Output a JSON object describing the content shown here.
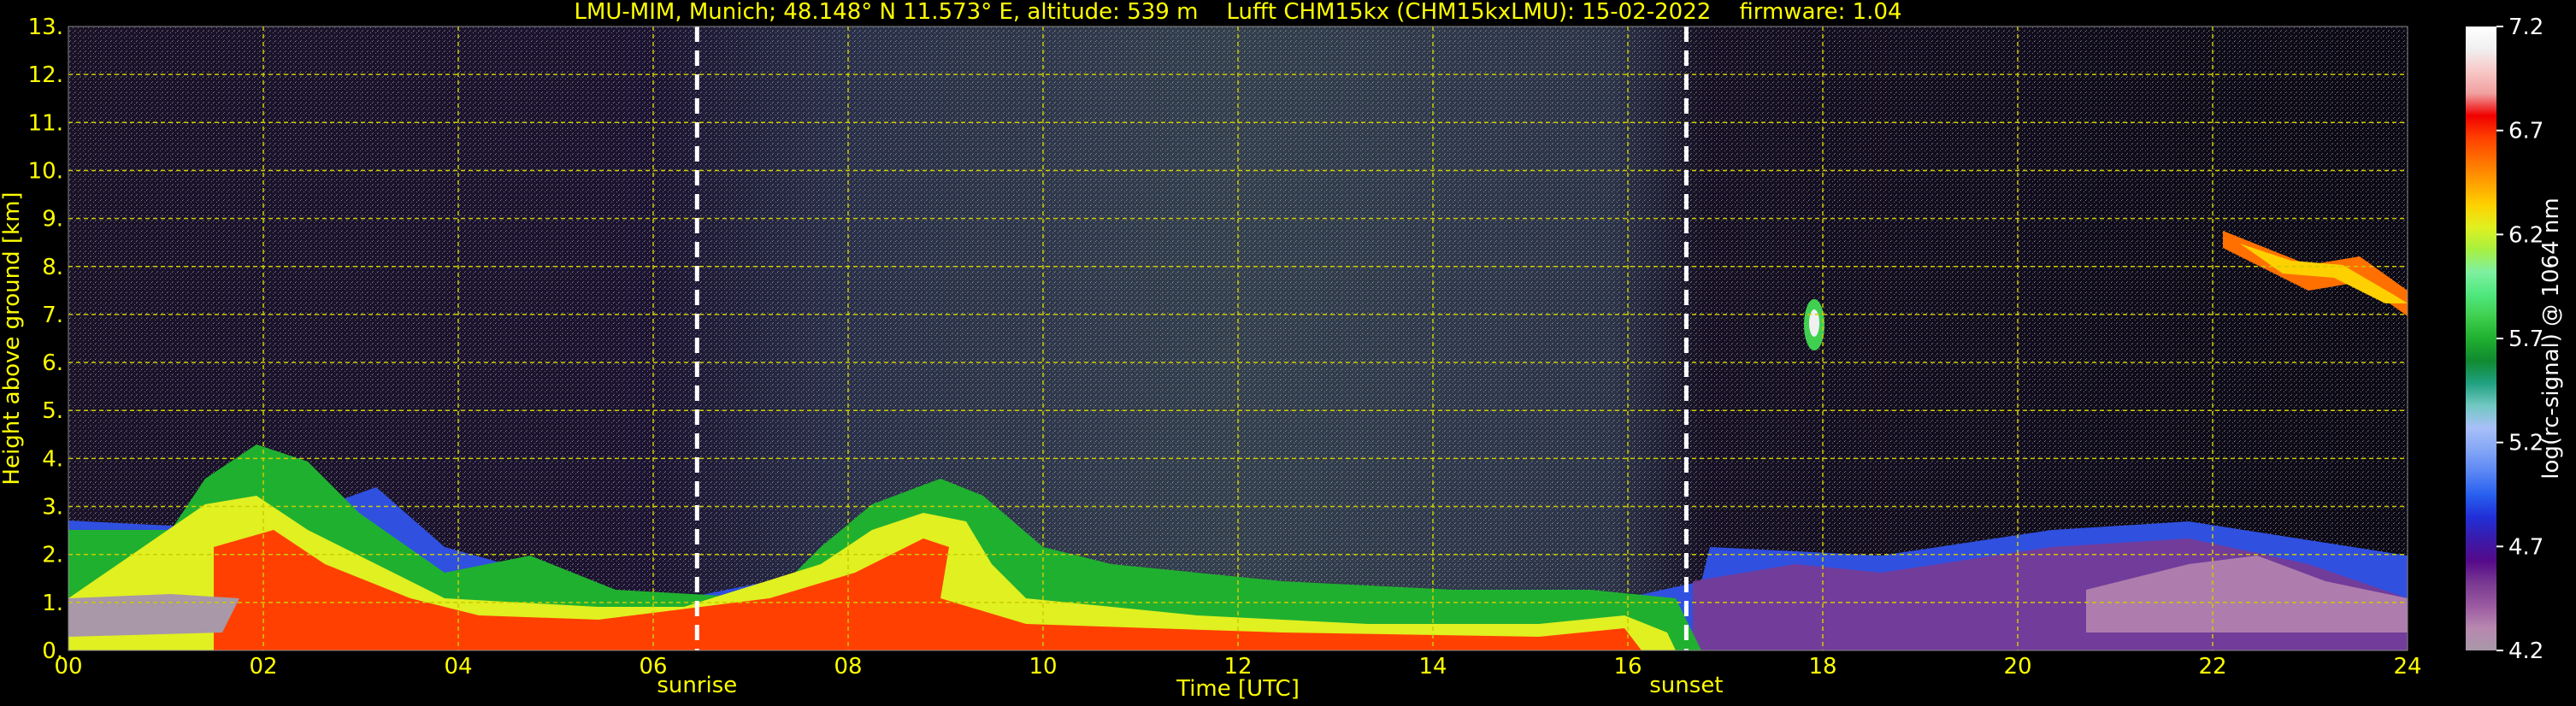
{
  "chart_data": {
    "type": "heatmap",
    "title": "LMU-MIM, Munich; 48.148° N 11.573° E, altitude: 539 m    Lufft CHM15kx (CHM15kxLMU): 15-02-2022    firmware: 1.04",
    "xlabel": "Time [UTC]",
    "ylabel": "Height above ground [km]",
    "xlim": [
      0,
      24
    ],
    "ylim": [
      0,
      13
    ],
    "x_ticks": [
      "00",
      "02",
      "04",
      "06",
      "08",
      "10",
      "12",
      "14",
      "16",
      "18",
      "20",
      "22",
      "24"
    ],
    "y_ticks": [
      "0.",
      "1.",
      "2.",
      "3.",
      "4.",
      "5.",
      "6.",
      "7.",
      "8.",
      "9.",
      "10.",
      "11.",
      "12.",
      "13."
    ],
    "grid": true,
    "sun_events": [
      {
        "label": "sunrise",
        "time": 6.45
      },
      {
        "label": "sunset",
        "time": 16.6
      }
    ],
    "colorbar": {
      "label": "log(rc-signal) @ 1064 nm",
      "ticks": [
        "4.2",
        "4.7",
        "5.2",
        "5.7",
        "6.2",
        "6.7",
        "7.2"
      ],
      "min": 4.2,
      "max": 7.2,
      "colors": [
        "#a898a8",
        "#b888b0",
        "#9a5aa0",
        "#7a3a92",
        "#560a8a",
        "#3a1aaa",
        "#2030d8",
        "#2860ee",
        "#5a86f4",
        "#84a6f6",
        "#a8c0f8",
        "#70c8c0",
        "#20a080",
        "#108a30",
        "#20b030",
        "#40d050",
        "#50e880",
        "#80f0a0",
        "#a8f040",
        "#e0f020",
        "#ffd000",
        "#ffa000",
        "#ff7000",
        "#ff4000",
        "#f00000",
        "#f0a0a0",
        "#f8c8c8",
        "#f0f0f0",
        "#ffffff"
      ]
    },
    "features": [
      {
        "name": "boundary layer aerosol",
        "x": [
          0,
          24
        ],
        "y": [
          0,
          2.5
        ]
      },
      {
        "name": "cloud",
        "x": [
          17.7,
          18.0
        ],
        "y": [
          6.4,
          7.3
        ]
      },
      {
        "name": "cloud",
        "x": [
          22.0,
          24.0
        ],
        "y": [
          6.9,
          9.0
        ]
      }
    ]
  },
  "colors": {
    "text": "#ffff00",
    "grid": "#cccc00",
    "background": "#000000",
    "sun_line": "#ffffff",
    "colorbar_label": "#ffffff"
  }
}
